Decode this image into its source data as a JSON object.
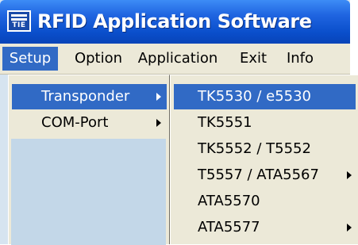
{
  "window": {
    "title": "RFID Application Software",
    "icon": "app-logo-icon",
    "icon_text": "TIE"
  },
  "menubar": {
    "items": [
      {
        "label": "Setup",
        "active": true
      },
      {
        "label": "Option",
        "active": false
      },
      {
        "label": "Application",
        "active": false
      },
      {
        "label": "Exit",
        "active": false
      },
      {
        "label": "Info",
        "active": false
      }
    ]
  },
  "setup_menu": {
    "items": [
      {
        "label": "Transponder",
        "has_submenu": true,
        "active": true
      },
      {
        "label": "COM-Port",
        "has_submenu": true,
        "active": false
      }
    ]
  },
  "transponder_submenu": {
    "items": [
      {
        "label": "TK5530 / e5530",
        "has_submenu": false,
        "active": true
      },
      {
        "label": "TK5551",
        "has_submenu": false,
        "active": false
      },
      {
        "label": "TK5552 / T5552",
        "has_submenu": false,
        "active": false
      },
      {
        "label": "T5557 / ATA5567",
        "has_submenu": true,
        "active": false
      },
      {
        "label": "ATA5570",
        "has_submenu": false,
        "active": false
      },
      {
        "label": "ATA5577",
        "has_submenu": true,
        "active": false
      }
    ]
  },
  "colors": {
    "titlebar": "#0a4ecb",
    "highlight": "#316ac5",
    "menu_bg": "#ece9d8"
  }
}
